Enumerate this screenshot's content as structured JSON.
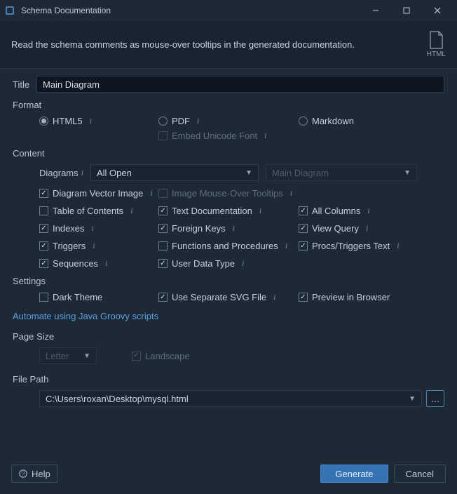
{
  "window": {
    "title": "Schema Documentation"
  },
  "banner": {
    "message": "Read the schema comments as mouse-over tooltips in the generated documentation.",
    "badge": "HTML"
  },
  "titleField": {
    "label": "Title",
    "value": "Main Diagram"
  },
  "format": {
    "label": "Format",
    "html5": "HTML5",
    "pdf": "PDF",
    "markdown": "Markdown",
    "embedFont": "Embed Unicode Font"
  },
  "content": {
    "label": "Content",
    "diagramsLabel": "Diagrams",
    "diagramsValue": "All Open",
    "disabledSelect": "Main Diagram",
    "diagramVectorImage": "Diagram Vector Image",
    "imageMouseOver": "Image Mouse-Over Tooltips",
    "tableOfContents": "Table of Contents",
    "textDocumentation": "Text Documentation",
    "allColumns": "All Columns",
    "indexes": "Indexes",
    "foreignKeys": "Foreign Keys",
    "viewQuery": "View Query",
    "triggers": "Triggers",
    "functionsProcedures": "Functions and Procedures",
    "procsTriggersText": "Procs/Triggers Text",
    "sequences": "Sequences",
    "userDataType": "User Data Type"
  },
  "settings": {
    "label": "Settings",
    "darkTheme": "Dark Theme",
    "useSeparateSvg": "Use Separate SVG File",
    "previewBrowser": "Preview in Browser"
  },
  "automateLink": "Automate using Java Groovy scripts",
  "pageSize": {
    "label": "Page Size",
    "value": "Letter",
    "landscape": "Landscape"
  },
  "filePath": {
    "label": "File Path",
    "value": "C:\\Users\\roxan\\Desktop\\mysql.html"
  },
  "footer": {
    "help": "Help",
    "generate": "Generate",
    "cancel": "Cancel"
  }
}
